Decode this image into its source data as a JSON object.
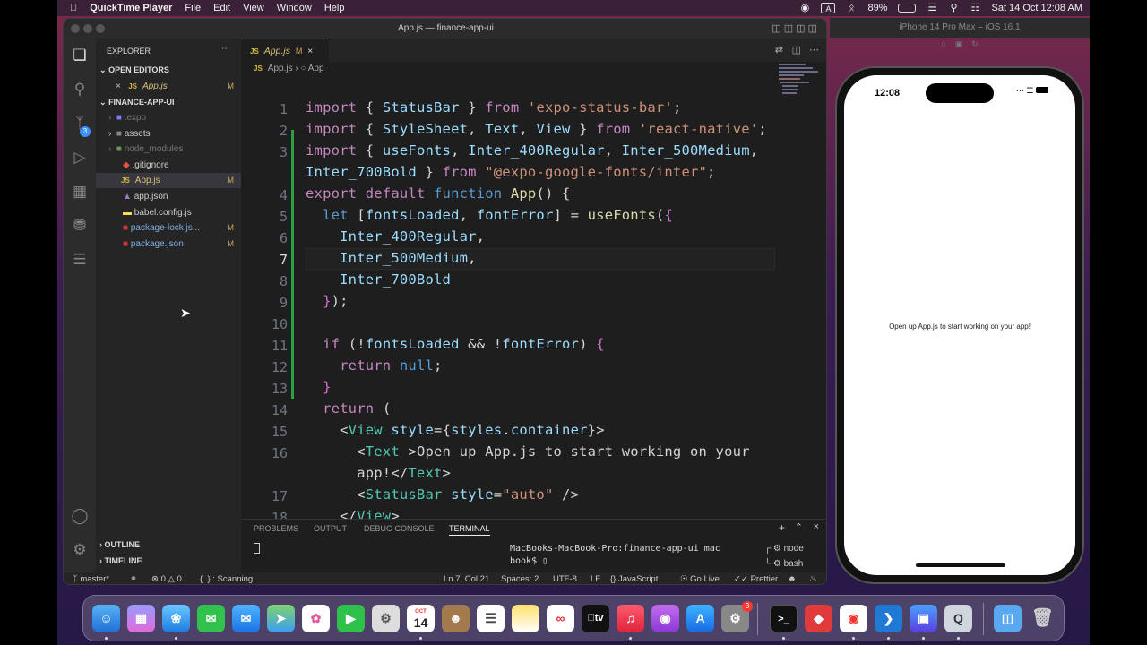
{
  "menubar": {
    "app": "QuickTime Player",
    "items": [
      "File",
      "Edit",
      "View",
      "Window",
      "Help"
    ],
    "battery": "89%",
    "datetime": "Sat 14 Oct  12:08 AM",
    "input": "A"
  },
  "vscode": {
    "title": "App.js — finance-app-ui",
    "explorer": "EXPLORER",
    "open_editors": "OPEN EDITORS",
    "open_file": "App.js",
    "modified": "M",
    "project": "FINANCE-APP-UI",
    "files": [
      ".expo",
      "assets",
      "node_modules",
      ".gitignore",
      "App.js",
      "app.json",
      "babel.config.js",
      "package-lock.js...",
      "package.json"
    ],
    "scm_badge": "3",
    "tab_label": "App.js",
    "tab_badge": "M",
    "breadcrumb_file": "App.js",
    "breadcrumb_symbol": "App",
    "line_numbers": [
      "1",
      "2",
      "3",
      "",
      "4",
      "5",
      "6",
      "7",
      "8",
      "9",
      "10",
      "11",
      "12",
      "13",
      "14",
      "15",
      "16",
      "",
      "17",
      "18"
    ],
    "outline": "OUTLINE",
    "timeline": "TIMELINE",
    "panel_tabs": [
      "PROBLEMS",
      "OUTPUT",
      "DEBUG CONSOLE",
      "TERMINAL"
    ],
    "terminal_text": "MacBooks-MacBook-Pro:finance-app-ui mac",
    "terminal_text2": "book$",
    "shells": [
      "node",
      "bash"
    ],
    "status": {
      "branch": "master*",
      "errors": "0",
      "warnings": "0",
      "scanning": "{..} : Scanning..",
      "position": "Ln 7, Col 21",
      "spaces": "Spaces: 2",
      "encoding": "UTF-8",
      "eol": "LF",
      "language": "JavaScript",
      "golive": "Go Live",
      "prettier": "Prettier"
    }
  },
  "simulator": {
    "title": "iPhone 14 Pro Max – iOS 16.1",
    "time": "12:08",
    "message": "Open up App.js to start working on your app!"
  },
  "dock": {
    "calendar_month": "OCT",
    "calendar_day": "14",
    "settings_badge": "3",
    "appletv": "tv"
  },
  "colors": {
    "keyword": "#c586c0",
    "function": "#dcdcaa",
    "string": "#ce9178",
    "variable": "#9cdcfe",
    "tag": "#4ec9b0",
    "accent": "#3794ff"
  }
}
